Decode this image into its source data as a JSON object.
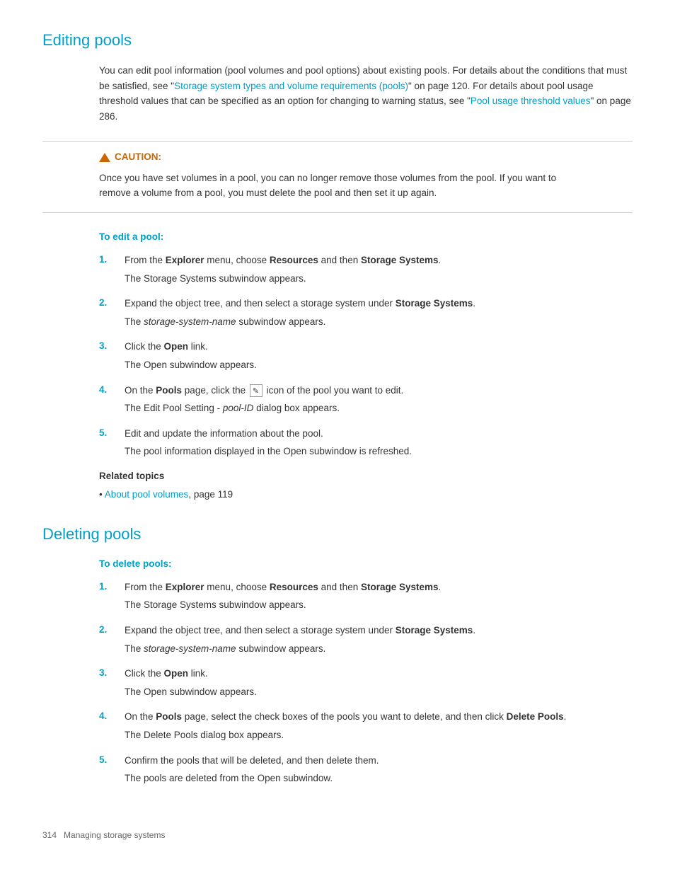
{
  "editing_pools": {
    "title": "Editing pools",
    "intro": {
      "text_before_link1": "You can edit pool information (pool volumes and pool options) about existing pools. For details about the conditions that must be satisfied, see \"",
      "link1_text": "Storage system types and volume requirements (pools)",
      "text_after_link1": "\" on page 120. For details about pool usage threshold values that can be specified as an option for changing to warning status, see \"",
      "link2_text": "Pool usage threshold values",
      "text_after_link2": "\" on page 286."
    },
    "caution": {
      "label": "CAUTION:",
      "text": "Once you have set volumes in a pool, you can no longer remove those volumes from the pool. If you want to remove a volume from a pool, you must delete the pool and then set it up again."
    },
    "procedure_title": "To edit a pool:",
    "steps": [
      {
        "number": "1.",
        "text_before_bold1": "From the ",
        "bold1": "Explorer",
        "text_between": " menu, choose ",
        "bold2": "Resources",
        "text_between2": " and then ",
        "bold3": "Storage Systems",
        "text_after": ".",
        "result": "The Storage Systems subwindow appears."
      },
      {
        "number": "2.",
        "text_before_bold": "Expand the object tree, and then select a storage system under ",
        "bold": "Storage Systems",
        "text_after": ".",
        "result_italic": "storage-system-name",
        "result_text": " subwindow appears."
      },
      {
        "number": "3.",
        "text_before_bold": "Click the ",
        "bold": "Open",
        "text_after": " link.",
        "result": "The Open subwindow appears."
      },
      {
        "number": "4.",
        "text_before_bold": "On the ",
        "bold": "Pools",
        "text_middle": " page, click the ",
        "icon_label": "[edit icon]",
        "text_after": " icon of the pool you want to edit.",
        "result_before_italic": "The Edit Pool Setting - ",
        "result_italic": "pool-ID",
        "result_after": " dialog box appears."
      },
      {
        "number": "5.",
        "text": "Edit and update the information about the pool.",
        "result": "The pool information displayed in the Open subwindow is refreshed."
      }
    ],
    "related_topics": {
      "title": "Related topics",
      "items": [
        {
          "link_text": "About pool volumes",
          "suffix": ", page 119"
        }
      ]
    }
  },
  "deleting_pools": {
    "title": "Deleting pools",
    "procedure_title": "To delete pools:",
    "steps": [
      {
        "number": "1.",
        "text_before_bold1": "From the ",
        "bold1": "Explorer",
        "text_between": " menu, choose ",
        "bold2": "Resources",
        "text_between2": " and then ",
        "bold3": "Storage Systems",
        "text_after": ".",
        "result": "The Storage Systems subwindow appears."
      },
      {
        "number": "2.",
        "text_before_bold": "Expand the object tree, and then select a storage system under ",
        "bold": "Storage Systems",
        "text_after": ".",
        "result_italic": "storage-system-name",
        "result_text": " subwindow appears."
      },
      {
        "number": "3.",
        "text_before_bold": "Click the ",
        "bold": "Open",
        "text_after": " link.",
        "result": "The Open subwindow appears."
      },
      {
        "number": "4.",
        "text_before_bold": "On the ",
        "bold": "Pools",
        "text_middle": " page, select the check boxes of the pools you want to delete, and then click ",
        "bold2": "Delete Pools",
        "text_after": ".",
        "result": "The Delete Pools dialog box appears."
      },
      {
        "number": "5.",
        "text": "Confirm the pools that will be deleted, and then delete them.",
        "result": "The pools are deleted from the Open subwindow."
      }
    ]
  },
  "footer": {
    "page_number": "314",
    "text": "Managing storage systems"
  }
}
